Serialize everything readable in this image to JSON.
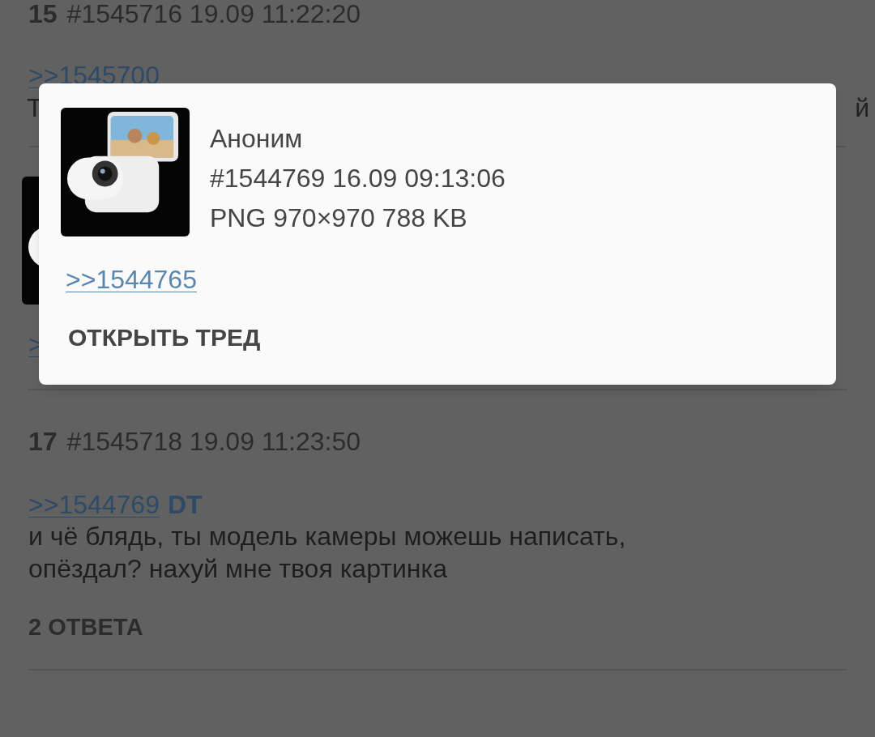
{
  "posts": [
    {
      "kind": "header_text",
      "number": "15",
      "meta": "#1545716 19.09 11:22:20",
      "reply_links": [
        ">>1545700"
      ],
      "text_fragments": [
        "Т",
        "й"
      ]
    },
    {
      "kind": "thumb_link",
      "thumbnail": {
        "kind": "picture"
      },
      "reply_links": [
        ">"
      ]
    },
    {
      "kind": "full",
      "number": "17",
      "meta": "#1545718 19.09 11:23:50",
      "reply_links": [
        ">>1544769"
      ],
      "tag": "DT",
      "body": "и чё блядь, ты модель камеры можешь написать, опёздал? нахуй мне твоя картинка",
      "replies": "2 ОТВЕТА"
    }
  ],
  "dialog": {
    "thumbnail": {
      "kind": "picture"
    },
    "author": "Аноним",
    "meta": "#1544769 16.09 09:13:06",
    "file": "PNG 970×970 788 KB",
    "reply_link": ">>1544765",
    "action": "ОТКРЫТЬ ТРЕД"
  }
}
